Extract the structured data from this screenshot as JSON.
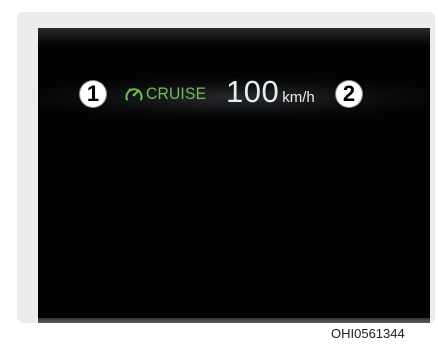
{
  "display": {
    "callout_1": "1",
    "callout_2": "2",
    "cruise_icon": "speedometer-icon",
    "cruise_label": "CRUISE",
    "set_speed": "100",
    "speed_unit": "km/h",
    "colors": {
      "cruise": "#6fbf55",
      "speed": "#e8ecef",
      "screen": "#030303",
      "panel": "#ececec"
    }
  },
  "figure": {
    "code": "OHI0561344"
  }
}
